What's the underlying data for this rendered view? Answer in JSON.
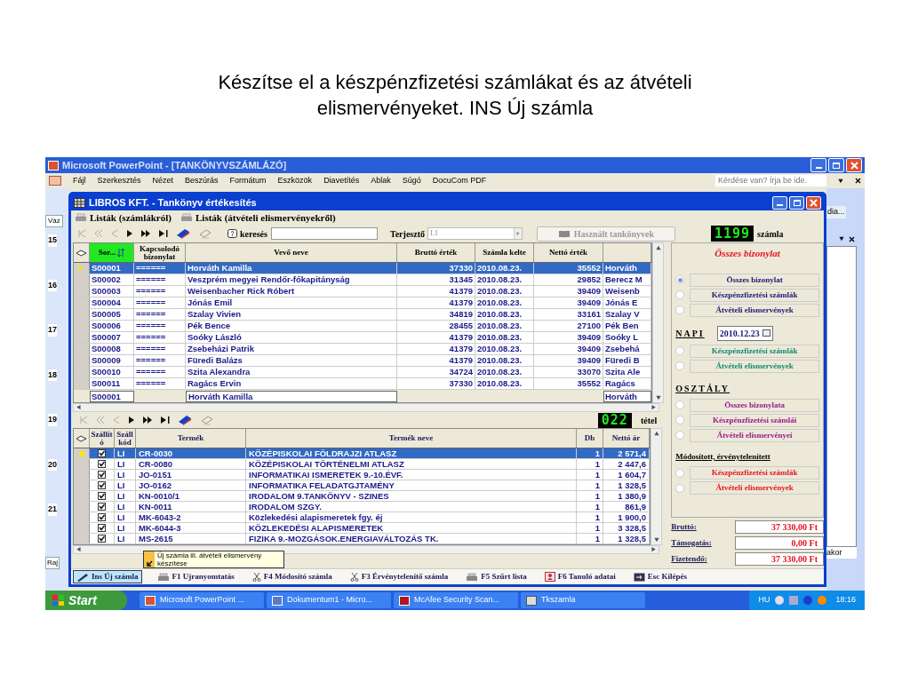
{
  "slide_title": "Készítse el a készpénzfizetési számlákat és az átvételi elismervényeket. INS Új számla",
  "ppt": {
    "title": "Microsoft PowerPoint - [TANKÖNYVSZÁMLÁZÓ]",
    "menu": [
      "Fájl",
      "Szerkesztés",
      "Nézet",
      "Beszúrás",
      "Formátum",
      "Eszközök",
      "Diavetítés",
      "Ablak",
      "Súgó",
      "DocuCom PDF"
    ],
    "help_placeholder": "Kérdése van? Írja be ide.",
    "left_tabs": [
      "Váz",
      "Raj"
    ],
    "slide_numbers": [
      "15",
      "16",
      "17",
      "18",
      "19",
      "20",
      "21"
    ],
    "right_texts": [
      "dia...",
      "akor"
    ]
  },
  "app": {
    "title": "LIBROS KFT. - Tankönyv értékesítés",
    "menu": [
      "Listák (számlákról)",
      "Listák (átvételi elismervényekről)"
    ],
    "search_label": "keresés",
    "distributor_label": "Terjesztő",
    "distributor_value": "LI",
    "used_books_button": "Használt tankönyvek",
    "invoice_count": "1199",
    "invoice_count_label": "számla",
    "invoices": {
      "columns": [
        {
          "label": "Sor...",
          "sorted": true
        },
        {
          "label": "Kapcsolodó bizonylat",
          "sorted": false
        },
        {
          "label": "Vevő neve",
          "sorted": false
        },
        {
          "label": "Bruttó érték",
          "sorted": false
        },
        {
          "label": "Számla kelte",
          "sorted": false
        },
        {
          "label": "Nettó érték",
          "sorted": false
        }
      ],
      "rows": [
        {
          "cells": [
            "S00001",
            "======",
            "Horváth Kamilla",
            "37330",
            "2010.08.23.",
            "35552",
            "Horváth"
          ],
          "selected": true
        },
        {
          "cells": [
            "S00002",
            "======",
            "Veszprém megyei Rendőr-főkapitányság",
            "31345",
            "2010.08.23.",
            "29852",
            "Berecz M"
          ],
          "selected": false
        },
        {
          "cells": [
            "S00003",
            "======",
            "Weisenbacher Rick Róbert",
            "41379",
            "2010.08.23.",
            "39409",
            "Weisenb"
          ],
          "selected": false
        },
        {
          "cells": [
            "S00004",
            "======",
            "Jónás Emil",
            "41379",
            "2010.08.23.",
            "39409",
            "Jónás E"
          ],
          "selected": false
        },
        {
          "cells": [
            "S00005",
            "======",
            "Szalay Vivien",
            "34819",
            "2010.08.23.",
            "33161",
            "Szalay V"
          ],
          "selected": false
        },
        {
          "cells": [
            "S00006",
            "======",
            "Pék Bence",
            "28455",
            "2010.08.23.",
            "27100",
            "Pék Ben"
          ],
          "selected": false
        },
        {
          "cells": [
            "S00007",
            "======",
            "Soóky László",
            "41379",
            "2010.08.23.",
            "39409",
            "Soóky L"
          ],
          "selected": false
        },
        {
          "cells": [
            "S00008",
            "======",
            "Zsebeházi Patrik",
            "41379",
            "2010.08.23.",
            "39409",
            "Zsebehá"
          ],
          "selected": false
        },
        {
          "cells": [
            "S00009",
            "======",
            "Füredi Balázs",
            "41379",
            "2010.08.23.",
            "39409",
            "Füredi B"
          ],
          "selected": false
        },
        {
          "cells": [
            "S00010",
            "======",
            "Szita Alexandra",
            "34724",
            "2010.08.23.",
            "33070",
            "Szita Ale"
          ],
          "selected": false
        },
        {
          "cells": [
            "S00011",
            "======",
            "Ragács Ervin",
            "37330",
            "2010.08.23.",
            "35552",
            "Ragács"
          ],
          "selected": false
        }
      ],
      "filter_row": {
        "sor": "S00001",
        "vevo": "Horváth Kamilla",
        "column_7": "Horváth"
      }
    },
    "item_count": "022",
    "item_count_label": "tétel",
    "items": {
      "columns": [
        "Szállító",
        "Száll kód",
        "Termék",
        "Termék neve",
        "Db",
        "Nettó ár"
      ],
      "rows": [
        {
          "checked": true,
          "szall_kod": "LI",
          "termek": "CR-0030",
          "termek_neve": "KÖZÉPISKOLAI FÖLDRAJZI ATLASZ",
          "db": "1",
          "netto_ar": "2 571,4",
          "selected": true
        },
        {
          "checked": true,
          "szall_kod": "LI",
          "termek": "CR-0080",
          "termek_neve": "KÖZÉPISKOLAI TÖRTÉNELMI ATLASZ",
          "db": "1",
          "netto_ar": "2 447,6",
          "selected": false
        },
        {
          "checked": true,
          "szall_kod": "LI",
          "termek": "JO-0151",
          "termek_neve": "INFORMATIKAI ISMERETEK 9.-10.ÉVF.",
          "db": "1",
          "netto_ar": "1 604,7",
          "selected": false
        },
        {
          "checked": true,
          "szall_kod": "LI",
          "termek": "JO-0162",
          "termek_neve": "INFORMATIKA FELADATGJTAMÉNY",
          "db": "1",
          "netto_ar": "1 328,5",
          "selected": false
        },
        {
          "checked": true,
          "szall_kod": "LI",
          "termek": "KN-0010/1",
          "termek_neve": "IRODALOM 9.TANKÖNYV - SZINES",
          "db": "1",
          "netto_ar": "1 380,9",
          "selected": false
        },
        {
          "checked": true,
          "szall_kod": "LI",
          "termek": "KN-0011",
          "termek_neve": "IRODALOM SZGY.",
          "db": "1",
          "netto_ar": "861,9",
          "selected": false
        },
        {
          "checked": true,
          "szall_kod": "LI",
          "termek": "MK-6043-2",
          "termek_neve": "Közlekedési alapismeretek fgy. éj",
          "db": "1",
          "netto_ar": "1 900,0",
          "selected": false
        },
        {
          "checked": true,
          "szall_kod": "LI",
          "termek": "MK-6044-3",
          "termek_neve": "KÖZLEKEDÉSI ALAPISMERETEK",
          "db": "1",
          "netto_ar": "3 328,5",
          "selected": false
        },
        {
          "checked": true,
          "szall_kod": "LI",
          "termek": "MS-2615",
          "termek_neve": "FIZIKA 9.-MOZGÁSOK.ENERGIAVÁLTOZÁS TK.",
          "db": "1",
          "netto_ar": "1 328,5",
          "selected": false
        }
      ]
    },
    "filter_panel": {
      "title": "Összes bizonylat",
      "groups": [
        {
          "color": "#1a1a7a",
          "options": [
            {
              "label": "Összes bizonylat",
              "selected": true
            },
            {
              "label": "Készpénzfizetési számlák",
              "selected": false
            },
            {
              "label": "Átvételi elismervények",
              "selected": false
            }
          ]
        },
        {
          "heading": "NAPI",
          "date": "2010.12.23",
          "color": "#138a72",
          "options": [
            {
              "label": "Készpénzfizetési számlák",
              "selected": false
            },
            {
              "label": "Átvételi elismervények",
              "selected": false
            }
          ]
        },
        {
          "heading": "OSZTÁLY",
          "color": "#9a1a8a",
          "options": [
            {
              "label": "Összes bizonylata",
              "selected": false
            },
            {
              "label": "Készpénzfizetési számlái",
              "selected": false
            },
            {
              "label": "Átvételi elismervényei",
              "selected": false
            }
          ]
        },
        {
          "heading": "Módosított, érvénytelenített",
          "color": "#e8141e",
          "options": [
            {
              "label": "Készpénzfizetési számlák",
              "selected": false
            },
            {
              "label": "Átvételi elismervények",
              "selected": false
            }
          ]
        }
      ]
    },
    "totals": [
      {
        "label": "Bruttó:",
        "value": "37 330,00 Ft"
      },
      {
        "label": "Támogatás:",
        "value": "0,00 Ft"
      },
      {
        "label": "Fizetendő:",
        "value": "37 330,00 Ft"
      }
    ],
    "tooltip": "Új számla ill. átvételi elismervény készítése",
    "function_keys": [
      {
        "label": "Ins Új számla",
        "selected": true
      },
      {
        "label": "F1 Ujranyomtatás",
        "selected": false
      },
      {
        "label": "F4 Módosító számla",
        "selected": false
      },
      {
        "label": "F3 Érvénytelenítő számla",
        "selected": false
      },
      {
        "label": "F5 Szűrt lista",
        "selected": false
      },
      {
        "label": "F6 Tanuló adatai",
        "selected": false
      },
      {
        "label": "Esc Kilépés",
        "selected": false
      }
    ]
  },
  "taskbar": {
    "start": "Start",
    "items": [
      "Microsoft PowerPoint ...",
      "Dokumentum1 - Micro...",
      "McAfee Security Scan...",
      "Tkszamla"
    ],
    "language": "HU",
    "clock": "18:16"
  }
}
